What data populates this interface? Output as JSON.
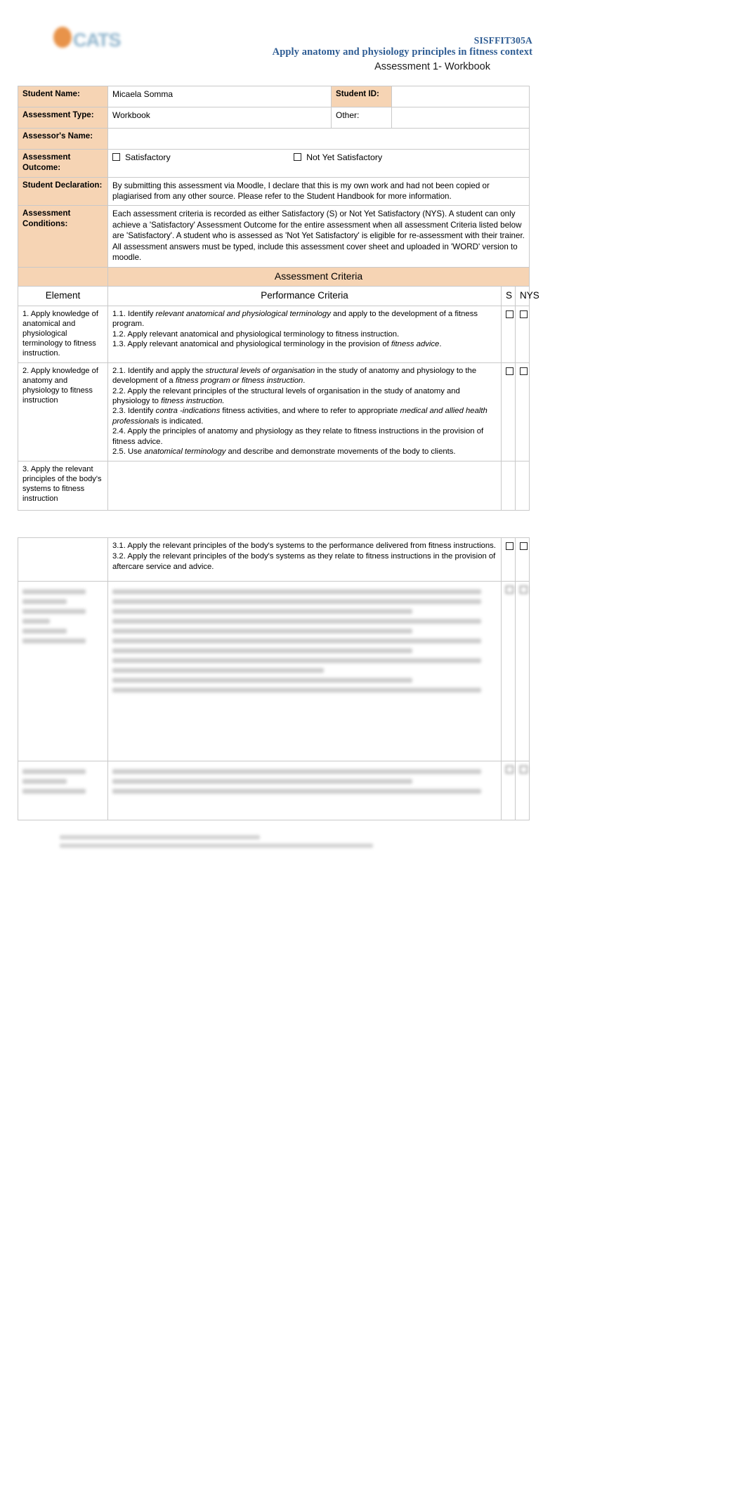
{
  "header": {
    "logo_word": "CATS",
    "unit_code": "SISFFIT305A",
    "unit_title": "Apply anatomy and physiology principles in fitness context",
    "assessment_label": "Assessment 1- Workbook"
  },
  "cover": {
    "labels": {
      "student_name": "Student Name:",
      "student_id": "Student ID:",
      "assessment_type": "Assessment Type:",
      "other": "Other:",
      "assessor_name": "Assessor's Name:",
      "assessment_outcome": "Assessment Outcome:",
      "student_declaration": "Student Declaration:",
      "assessment_conditions": "Assessment Conditions:"
    },
    "values": {
      "student_name": "Micaela Somma",
      "student_id": "",
      "assessment_type": "Workbook",
      "assessor_name": ""
    },
    "outcome_options": [
      {
        "label": "Satisfactory",
        "checked": false
      },
      {
        "label": "Not Yet Satisfactory",
        "checked": false
      }
    ],
    "declaration_text": "By submitting this assessment via Moodle, I declare that this is my own work and had not been copied or plagiarised from any other source. Please refer to the Student Handbook for more information.",
    "conditions_paragraphs": [
      "Each assessment criteria is recorded as either Satisfactory (S) or Not Yet Satisfactory (NYS). A student can only achieve a 'Satisfactory' Assessment Outcome for the entire assessment when all assessment Criteria listed below are 'Satisfactory'. A student who is assessed as 'Not Yet Satisfactory' is eligible for re-assessment with their trainer.",
      "All assessment answers must be typed, include this assessment cover sheet and uploaded in 'WORD' version to moodle."
    ]
  },
  "criteria": {
    "banner": "Assessment Criteria",
    "columns": {
      "element": "Element",
      "performance": "Performance Criteria",
      "s": "S",
      "nys": "NYS"
    },
    "rows": [
      {
        "element": "1. Apply knowledge of anatomical and physiological terminology to fitness instruction.",
        "items": [
          "1.1. Identify <em>relevant anatomical and physiological terminology</em> and apply to the development of a fitness program.",
          "1.2. Apply relevant anatomical and physiological terminology to fitness instruction.",
          "1.3. Apply relevant anatomical and physiological terminology in the provision of <em>fitness advice</em>."
        ],
        "s_checked": false,
        "nys_checked": false
      },
      {
        "element": "2. Apply knowledge of anatomy and physiology to fitness instruction",
        "items": [
          "2.1. Identify and apply the <em>structural levels of organisation</em> in the study of anatomy and physiology to the development of a <em>fitness program or fitness instruction</em>.",
          "2.2. Apply the relevant principles of the structural levels of organisation in the study of anatomy and physiology to <em>fitness instruction.</em>",
          "2.3. Identify <em>contra -indications</em> fitness activities, and where to refer to appropriate <em>medical and allied health professionals</em> is indicated.",
          "2.4. Apply the principles of anatomy and physiology as they relate to fitness instructions in the provision of fitness advice.",
          "2.5. Use <em>anatomical terminology</em> and describe and demonstrate movements of the body to clients."
        ],
        "s_checked": false,
        "nys_checked": false
      },
      {
        "element": "3. Apply the relevant principles of the body's systems to fitness instruction",
        "items": [],
        "s_checked": false,
        "nys_checked": false
      }
    ],
    "continued_rows": [
      {
        "element": "",
        "items": [
          "3.1. Apply the relevant principles of the body's systems to the performance delivered from fitness instructions.",
          "3.2. Apply the relevant principles of the body's systems as they relate to fitness instructions in the provision of aftercare service and advice."
        ],
        "s_checked": false,
        "nys_checked": false
      }
    ]
  }
}
